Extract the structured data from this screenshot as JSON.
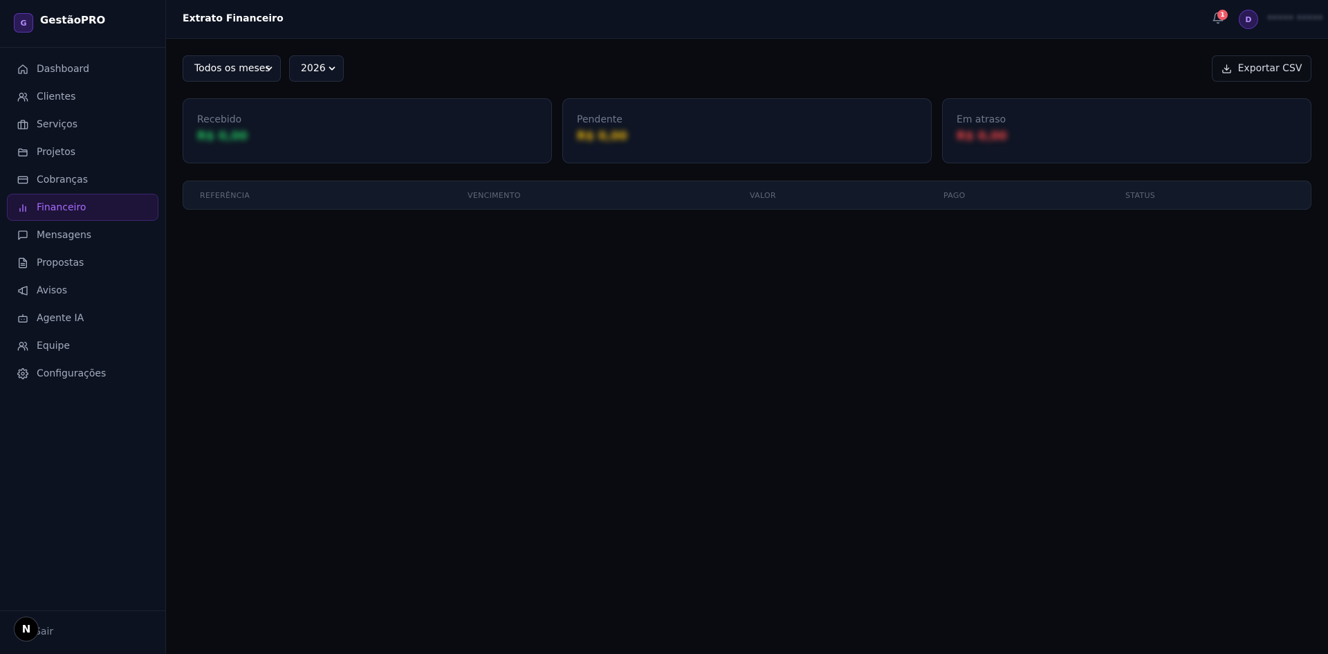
{
  "brand": {
    "logo_letter": "G",
    "name": "GestãoPRO"
  },
  "sidebar": {
    "items": [
      {
        "label": "Dashboard",
        "icon": "home-icon",
        "active": false
      },
      {
        "label": "Clientes",
        "icon": "users-icon",
        "active": false
      },
      {
        "label": "Serviços",
        "icon": "briefcase-icon",
        "active": false
      },
      {
        "label": "Projetos",
        "icon": "folder-icon",
        "active": false
      },
      {
        "label": "Cobranças",
        "icon": "credit-card-icon",
        "active": false
      },
      {
        "label": "Financeiro",
        "icon": "bar-chart-icon",
        "active": true
      },
      {
        "label": "Mensagens",
        "icon": "message-icon",
        "active": false
      },
      {
        "label": "Propostas",
        "icon": "file-text-icon",
        "active": false
      },
      {
        "label": "Avisos",
        "icon": "megaphone-icon",
        "active": false
      },
      {
        "label": "Agente IA",
        "icon": "bot-icon",
        "active": false
      },
      {
        "label": "Equipe",
        "icon": "users-icon",
        "active": false
      },
      {
        "label": "Configurações",
        "icon": "gear-icon",
        "active": false
      }
    ],
    "logout_label": "Sair",
    "dev_badge": "N"
  },
  "header": {
    "title": "Extrato Financeiro",
    "notification_count": "1",
    "avatar_letter": "D",
    "user_name": "••••• •••••"
  },
  "filters": {
    "month_value": "Todos os meses",
    "year_value": "2026",
    "export_label": "Exportar CSV"
  },
  "summary": {
    "received": {
      "label": "Recebido",
      "value": "R$ 0,00",
      "color": "#22c55e"
    },
    "pending": {
      "label": "Pendente",
      "value": "R$ 0,00",
      "color": "#eab308"
    },
    "overdue": {
      "label": "Em atraso",
      "value": "R$ 0,00",
      "color": "#ef4444"
    }
  },
  "table": {
    "columns": [
      "REFERÊNCIA",
      "VENCIMENTO",
      "VALOR",
      "PAGO",
      "STATUS"
    ],
    "rows": []
  },
  "colors": {
    "accent": "#a56bff",
    "background": "#090b10",
    "sidebar": "#0c1220"
  }
}
